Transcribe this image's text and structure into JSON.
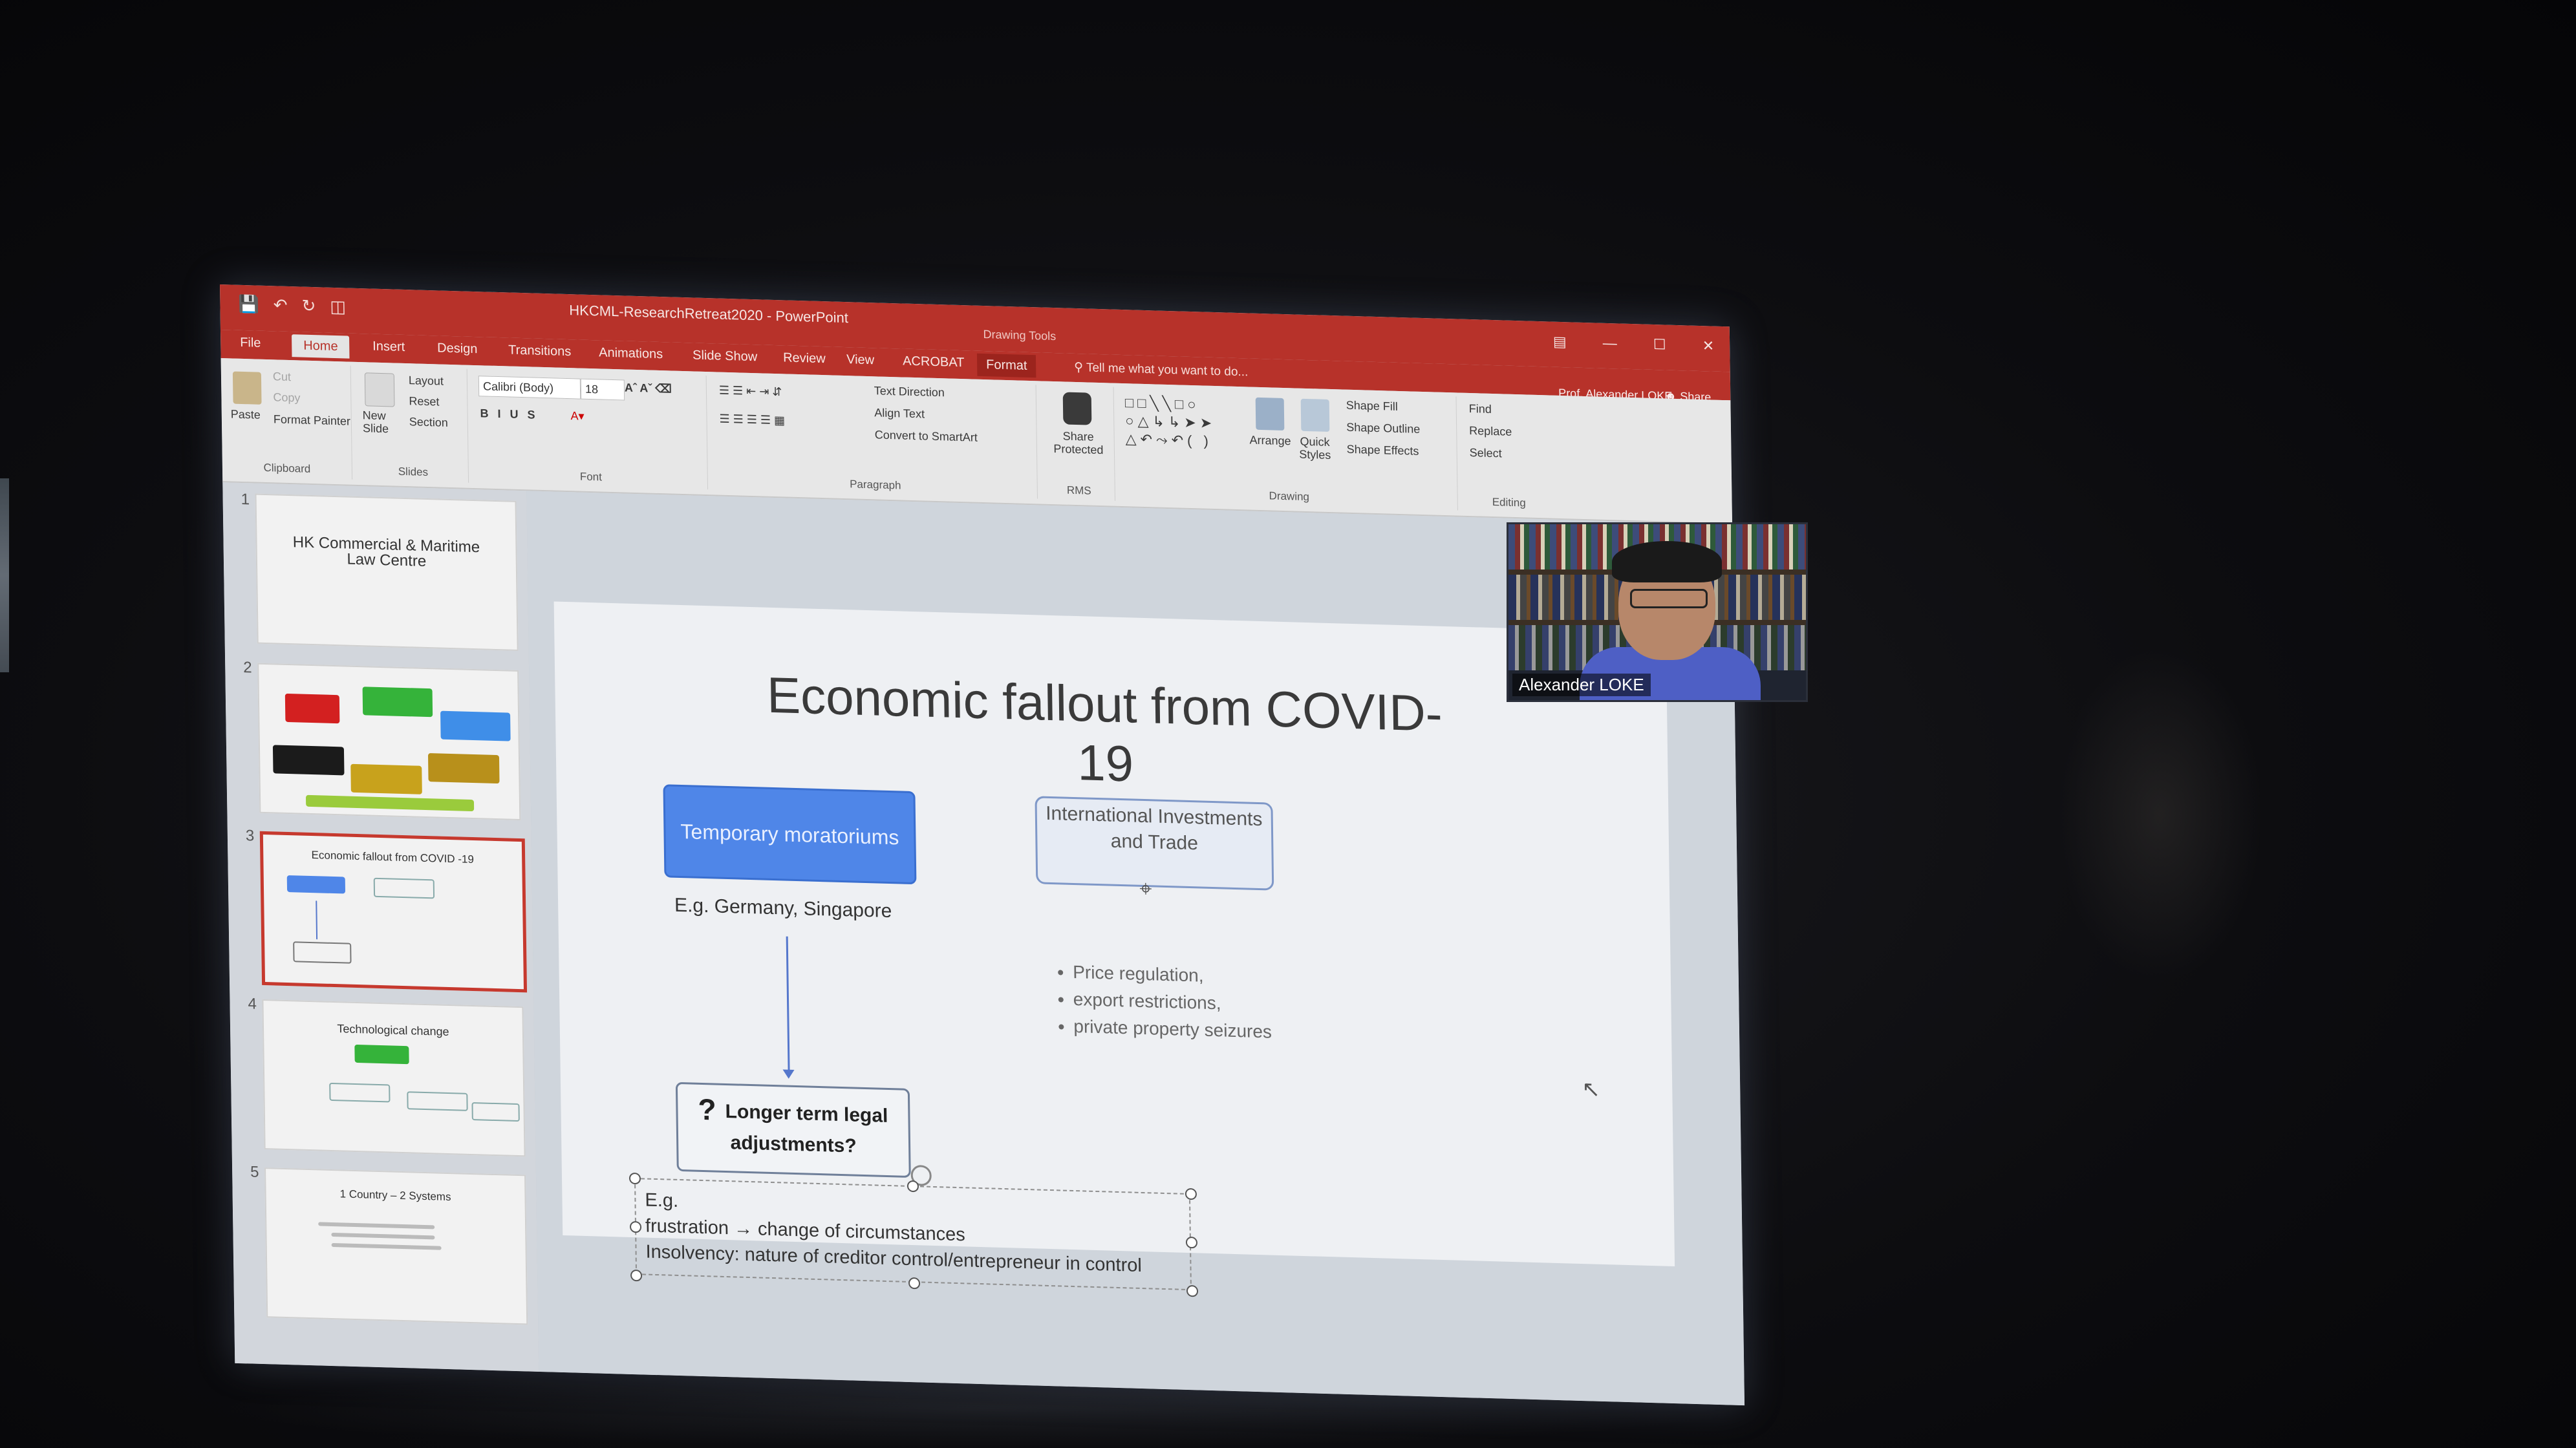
{
  "app": {
    "document_title": "HKCML-ResearchRetreat2020 - PowerPoint",
    "contextual_title": "Drawing Tools",
    "user_name": "Prof. Alexander LOKE",
    "share_label": "Share",
    "tell_me": "Tell me what you want to do..."
  },
  "tabs": [
    "File",
    "Home",
    "Insert",
    "Design",
    "Transitions",
    "Animations",
    "Slide Show",
    "Review",
    "View",
    "ACROBAT",
    "Format"
  ],
  "ribbon": {
    "clipboard": {
      "paste": "Paste",
      "cut": "Cut",
      "copy": "Copy",
      "format_painter": "Format Painter",
      "label": "Clipboard"
    },
    "slides": {
      "new_slide": "New Slide",
      "layout": "Layout",
      "reset": "Reset",
      "section": "Section",
      "label": "Slides"
    },
    "font": {
      "family": "Calibri (Body)",
      "size": "18",
      "label": "Font"
    },
    "paragraph": {
      "text_direction": "Text Direction",
      "align_text": "Align Text",
      "convert_smartart": "Convert to SmartArt",
      "label": "Paragraph"
    },
    "rms": {
      "share_protected": "Share Protected",
      "label": "RMS"
    },
    "drawing": {
      "arrange": "Arrange",
      "quick_styles": "Quick Styles",
      "shape_fill": "Shape Fill",
      "shape_outline": "Shape Outline",
      "shape_effects": "Shape Effects",
      "label": "Drawing"
    },
    "editing": {
      "find": "Find",
      "replace": "Replace",
      "select": "Select",
      "label": "Editing"
    }
  },
  "thumbnails": [
    {
      "num": "1",
      "title": "HK Commercial & Maritime Law Centre"
    },
    {
      "num": "2",
      "title": ""
    },
    {
      "num": "3",
      "title": "Economic fallout from COVID -19"
    },
    {
      "num": "4",
      "title": "Technological change"
    },
    {
      "num": "5",
      "title": "1 Country – 2 Systems"
    }
  ],
  "slide": {
    "title": "Economic fallout from COVID-19",
    "box_left": "Temporary moratoriums",
    "box_right": "International Investments and Trade",
    "caption": "E.g. Germany, Singapore",
    "bullets": [
      "Price regulation,",
      "export restrictions,",
      "private property seizures"
    ],
    "question_mark": "?",
    "question_box": "Longer term legal adjustments?",
    "textbox_lines": [
      "E.g.",
      "frustration → change of circumstances",
      "Insolvency: nature of creditor control/entrepreneur in control"
    ]
  },
  "video": {
    "participant_name": "Alexander LOKE"
  },
  "colors": {
    "titlebar": "#b7322a",
    "accent_blue": "#4f86e8",
    "selected_thumb": "#c6392e"
  }
}
